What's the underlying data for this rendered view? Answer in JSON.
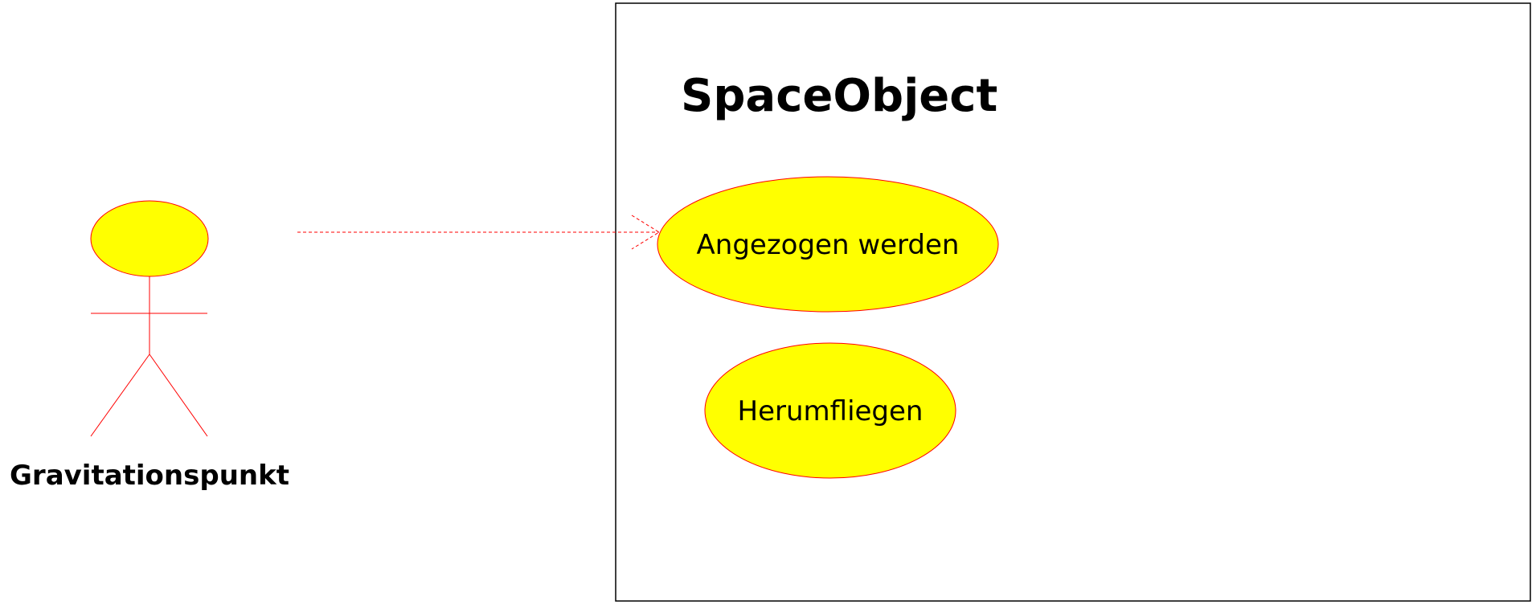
{
  "diagram": {
    "actor": {
      "label": "Gravitationspunkt"
    },
    "system": {
      "title": "SpaceObject"
    },
    "use_cases": [
      {
        "label": "Angezogen werden"
      },
      {
        "label": "Herumfliegen"
      }
    ],
    "colors": {
      "fill": "#ffff00",
      "stroke": "#ff0000",
      "boundary": "#000000",
      "background": "#ffffff"
    }
  }
}
